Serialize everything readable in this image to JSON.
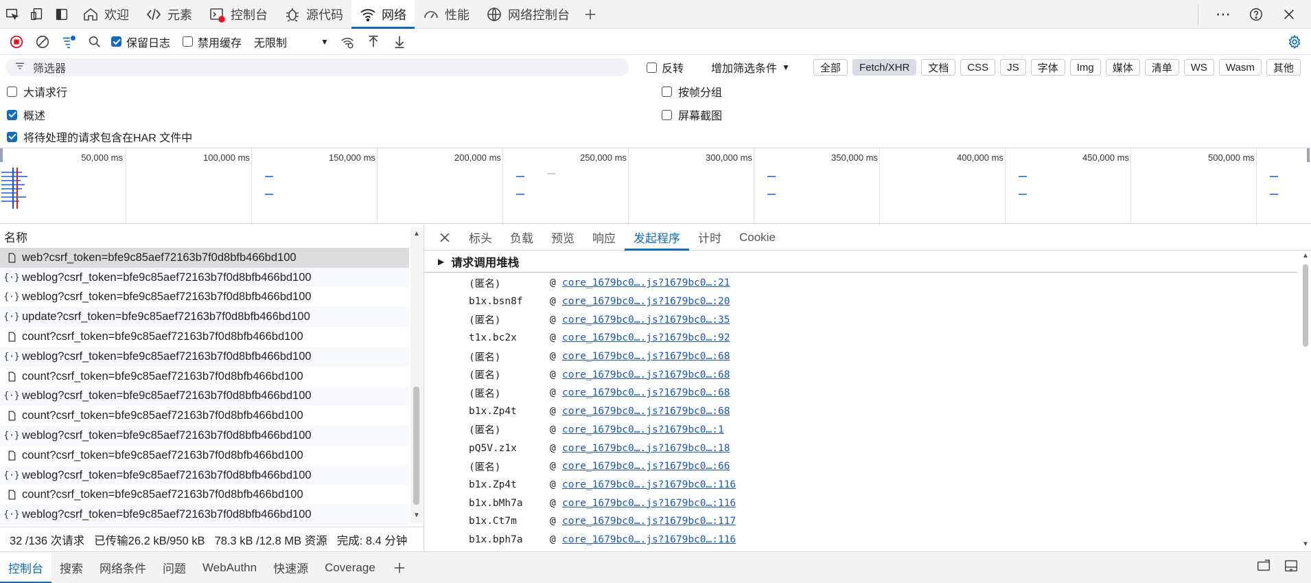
{
  "top_tabs": [
    {
      "label": "欢迎",
      "icon": "home-icon"
    },
    {
      "label": "元素",
      "icon": "code-icon"
    },
    {
      "label": "控制台",
      "icon": "console-icon"
    },
    {
      "label": "源代码",
      "icon": "bug-icon"
    },
    {
      "label": "网络",
      "icon": "wifi-icon",
      "active": true
    },
    {
      "label": "性能",
      "icon": "gauge-icon"
    },
    {
      "label": "网络控制台",
      "icon": "globe-icon"
    }
  ],
  "toolbar": {
    "preserve_log": "保留日志",
    "disable_cache": "禁用缓存",
    "throttling": "无限制"
  },
  "filter": {
    "placeholder": "筛选器",
    "invert": "反转",
    "more_filters": "增加筛选条件",
    "chips": [
      "全部",
      "Fetch/XHR",
      "文档",
      "CSS",
      "JS",
      "字体",
      "Img",
      "媒体",
      "清单",
      "WS",
      "Wasm",
      "其他"
    ],
    "selected": "Fetch/XHR"
  },
  "options": {
    "big_rows": "大请求行",
    "overview": "概述",
    "har_pending": "将待处理的请求包含在HAR 文件中",
    "group_by_frame": "按帧分组",
    "screenshots": "屏幕截图"
  },
  "overview_ticks": [
    "50,000 ms",
    "100,000 ms",
    "150,000 ms",
    "200,000 ms",
    "250,000 ms",
    "300,000 ms",
    "350,000 ms",
    "400,000 ms",
    "450,000 ms",
    "500,000 ms"
  ],
  "name_header": "名称",
  "requests": [
    {
      "name": "web?csrf_token=bfe9c85aef72163b7f0d8bfb466bd100",
      "icon": "doc-icon"
    },
    {
      "name": "weblog?csrf_token=bfe9c85aef72163b7f0d8bfb466bd100",
      "icon": "xhr-icon"
    },
    {
      "name": "weblog?csrf_token=bfe9c85aef72163b7f0d8bfb466bd100",
      "icon": "xhr-icon"
    },
    {
      "name": "update?csrf_token=bfe9c85aef72163b7f0d8bfb466bd100",
      "icon": "xhr-icon"
    },
    {
      "name": "count?csrf_token=bfe9c85aef72163b7f0d8bfb466bd100",
      "icon": "doc-icon"
    },
    {
      "name": "weblog?csrf_token=bfe9c85aef72163b7f0d8bfb466bd100",
      "icon": "xhr-icon"
    },
    {
      "name": "count?csrf_token=bfe9c85aef72163b7f0d8bfb466bd100",
      "icon": "doc-icon"
    },
    {
      "name": "weblog?csrf_token=bfe9c85aef72163b7f0d8bfb466bd100",
      "icon": "xhr-icon"
    },
    {
      "name": "count?csrf_token=bfe9c85aef72163b7f0d8bfb466bd100",
      "icon": "doc-icon"
    },
    {
      "name": "weblog?csrf_token=bfe9c85aef72163b7f0d8bfb466bd100",
      "icon": "xhr-icon"
    },
    {
      "name": "count?csrf_token=bfe9c85aef72163b7f0d8bfb466bd100",
      "icon": "doc-icon"
    },
    {
      "name": "weblog?csrf_token=bfe9c85aef72163b7f0d8bfb466bd100",
      "icon": "xhr-icon"
    },
    {
      "name": "count?csrf_token=bfe9c85aef72163b7f0d8bfb466bd100",
      "icon": "doc-icon"
    },
    {
      "name": "weblog?csrf_token=bfe9c85aef72163b7f0d8bfb466bd100",
      "icon": "xhr-icon"
    }
  ],
  "status": {
    "requests": "32 /136 次请求",
    "transferred": "已传输26.2 kB/950 kB",
    "resources": "78.3 kB /12.8 MB 资源",
    "finish": "完成: 8.4 分钟"
  },
  "detail_tabs": [
    "标头",
    "负载",
    "预览",
    "响应",
    "发起程序",
    "计时",
    "Cookie"
  ],
  "detail_active": "发起程序",
  "stack_title": "请求调用堆栈",
  "stack": [
    {
      "fn": "(匿名)",
      "src": "core_1679bc0….js?1679bc0…:21"
    },
    {
      "fn": "b1x.bsn8f",
      "src": "core_1679bc0….js?1679bc0…:20"
    },
    {
      "fn": "(匿名)",
      "src": "core_1679bc0….js?1679bc0…:35"
    },
    {
      "fn": "t1x.bc2x",
      "src": "core_1679bc0….js?1679bc0…:92"
    },
    {
      "fn": "(匿名)",
      "src": "core_1679bc0….js?1679bc0…:68"
    },
    {
      "fn": "(匿名)",
      "src": "core_1679bc0….js?1679bc0…:68"
    },
    {
      "fn": "(匿名)",
      "src": "core_1679bc0….js?1679bc0…:68"
    },
    {
      "fn": "b1x.Zp4t",
      "src": "core_1679bc0….js?1679bc0…:68"
    },
    {
      "fn": "(匿名)",
      "src": "core_1679bc0….js?1679bc0…:1"
    },
    {
      "fn": "pQ5V.z1x",
      "src": "core_1679bc0….js?1679bc0…:18"
    },
    {
      "fn": "(匿名)",
      "src": "core_1679bc0….js?1679bc0…:66"
    },
    {
      "fn": "b1x.Zp4t",
      "src": "core_1679bc0….js?1679bc0…:116"
    },
    {
      "fn": "b1x.bMh7a",
      "src": "core_1679bc0….js?1679bc0…:116"
    },
    {
      "fn": "b1x.Ct7m",
      "src": "core_1679bc0….js?1679bc0…:117"
    },
    {
      "fn": "b1x.bph7a",
      "src": "core_1679bc0….js?1679bc0…:116"
    }
  ],
  "bottom_tabs": [
    "控制台",
    "搜索",
    "网络条件",
    "问题",
    "WebAuthn",
    "快速源",
    "Coverage"
  ],
  "bottom_active": "控制台",
  "colors": {
    "accent": "#0f6cbd",
    "record": "#e81123",
    "link": "#1a56b8"
  }
}
